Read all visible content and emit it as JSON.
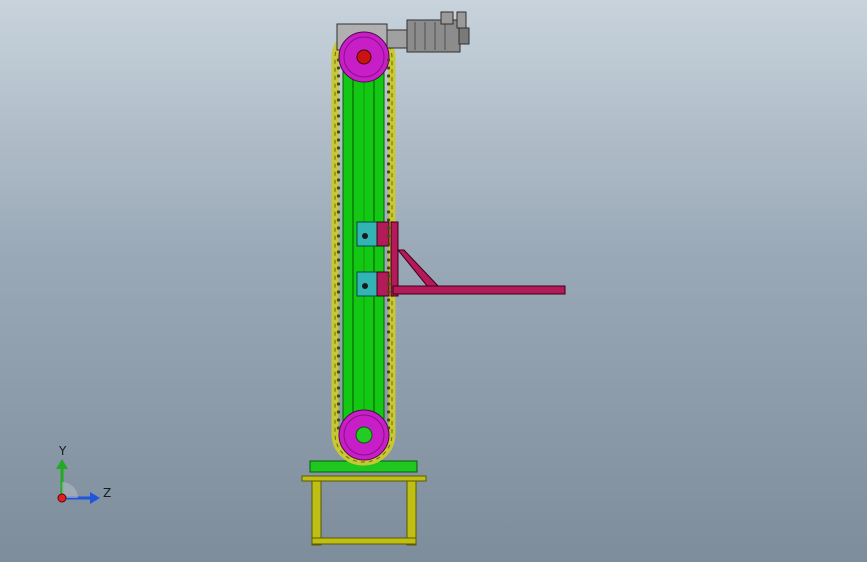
{
  "viewport": {
    "background_top": "#c8d3dc",
    "background_bottom": "#7d8d9b"
  },
  "colors": {
    "frame_green": "#13c813",
    "frame_green_dark": "#0a7a0a",
    "chain_yellow": "#c8c832",
    "sprocket_magenta": "#c81ec8",
    "hub_green": "#22cc22",
    "hub_red": "#cc1111",
    "arm_crimson": "#b4195a",
    "bracket_teal": "#32b4b4",
    "table_olive": "#bebe14",
    "motor_gray": "#8c8c8c"
  },
  "triad": {
    "y_label": "Y",
    "z_label": "Z",
    "y_color": "#22aa22",
    "z_color": "#2255dd",
    "x_color": "#dd2222"
  }
}
